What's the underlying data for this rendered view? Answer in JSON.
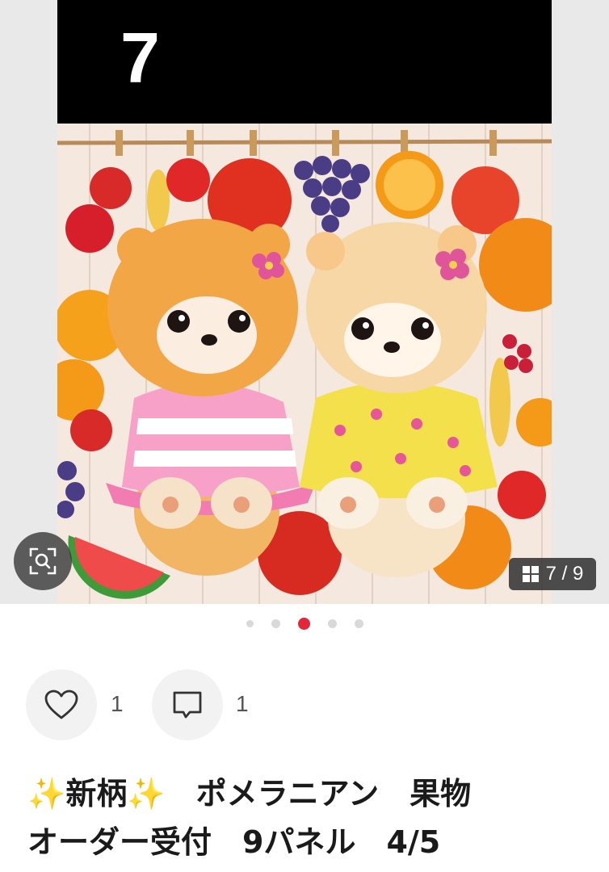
{
  "photo": {
    "overlay_number": "7",
    "counter": "7 / 9",
    "counter_icon": "grid-icon",
    "zoom_icon": "image-search-icon"
  },
  "pagination": {
    "total_dots": 5,
    "active_index": 2,
    "active_color": "#e6243a"
  },
  "actions": {
    "like": {
      "icon": "heart-icon",
      "count": "1"
    },
    "comment": {
      "icon": "comment-icon",
      "count": "1"
    }
  },
  "post": {
    "title_line1": "✨新柄✨　ポメラニアン　果物",
    "title_line2": "オーダー受付　9パネル　4/5"
  }
}
